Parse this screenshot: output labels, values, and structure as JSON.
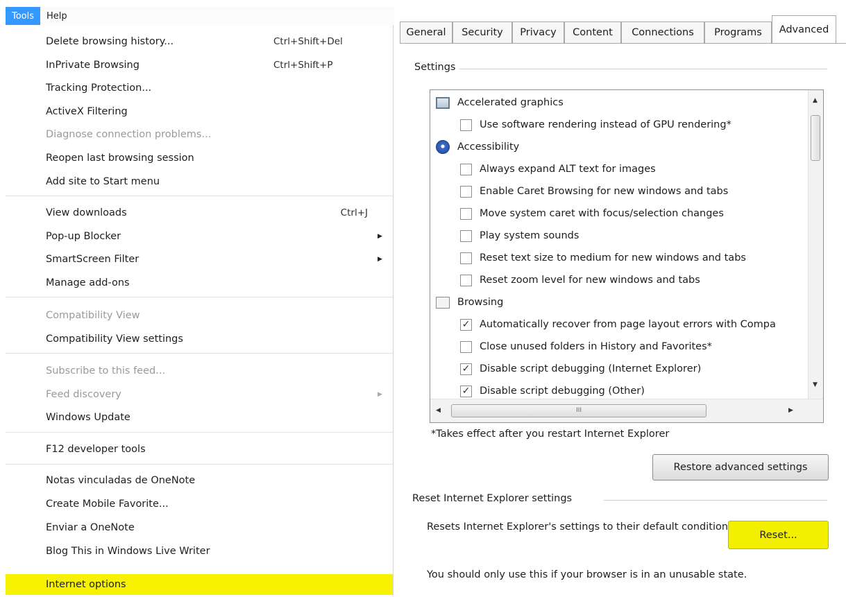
{
  "menubar": {
    "tools": "Tools",
    "help": "Help"
  },
  "menu": {
    "items": [
      {
        "label": "Delete browsing history...",
        "shortcut": "Ctrl+Shift+Del"
      },
      {
        "label": "InPrivate Browsing",
        "shortcut": "Ctrl+Shift+P"
      },
      {
        "label": "Tracking Protection..."
      },
      {
        "label": "ActiveX Filtering"
      },
      {
        "label": "Diagnose connection problems..."
      },
      {
        "label": "Reopen last browsing session"
      },
      {
        "label": "Add site to Start menu"
      },
      {
        "label": "View downloads",
        "shortcut": "Ctrl+J"
      },
      {
        "label": "Pop-up Blocker"
      },
      {
        "label": "SmartScreen Filter"
      },
      {
        "label": "Manage add-ons"
      },
      {
        "label": "Compatibility View"
      },
      {
        "label": "Compatibility View settings"
      },
      {
        "label": "Subscribe to this feed..."
      },
      {
        "label": "Feed discovery"
      },
      {
        "label": "Windows Update"
      },
      {
        "label": "F12 developer tools"
      },
      {
        "label": "Notas vinculadas de OneNote"
      },
      {
        "label": "Create Mobile Favorite..."
      },
      {
        "label": "Enviar a OneNote"
      },
      {
        "label": "Blog This in Windows Live Writer"
      },
      {
        "label": "Internet options"
      }
    ]
  },
  "tabs": [
    "General",
    "Security",
    "Privacy",
    "Content",
    "Connections",
    "Programs",
    "Advanced"
  ],
  "settings": {
    "group_label": "Settings",
    "tree": [
      {
        "label": "Accelerated graphics"
      },
      {
        "label": "Use software rendering instead of GPU rendering*"
      },
      {
        "label": "Accessibility"
      },
      {
        "label": "Always expand ALT text for images"
      },
      {
        "label": "Enable Caret Browsing for new windows and tabs"
      },
      {
        "label": "Move system caret with focus/selection changes"
      },
      {
        "label": "Play system sounds"
      },
      {
        "label": "Reset text size to medium for new windows and tabs"
      },
      {
        "label": "Reset zoom level for new windows and tabs"
      },
      {
        "label": "Browsing"
      },
      {
        "label": "Automatically recover from page layout errors with Compa"
      },
      {
        "label": "Close unused folders in History and Favorites*"
      },
      {
        "label": "Disable script debugging (Internet Explorer)"
      },
      {
        "label": "Disable script debugging (Other)"
      }
    ],
    "check_mark": "✓",
    "hscroll_grip": "III",
    "note": "*Takes effect after you restart Internet Explorer",
    "restore_button": "Restore advanced settings"
  },
  "reset": {
    "group_label": "Reset Internet Explorer settings",
    "description": "Resets Internet Explorer's settings to their default condition.",
    "button": "Reset...",
    "warning": "You should only use this if your browser is in an unusable state."
  },
  "colors": {
    "highlight": "#f7f300",
    "menu_active": "#3399ff"
  }
}
